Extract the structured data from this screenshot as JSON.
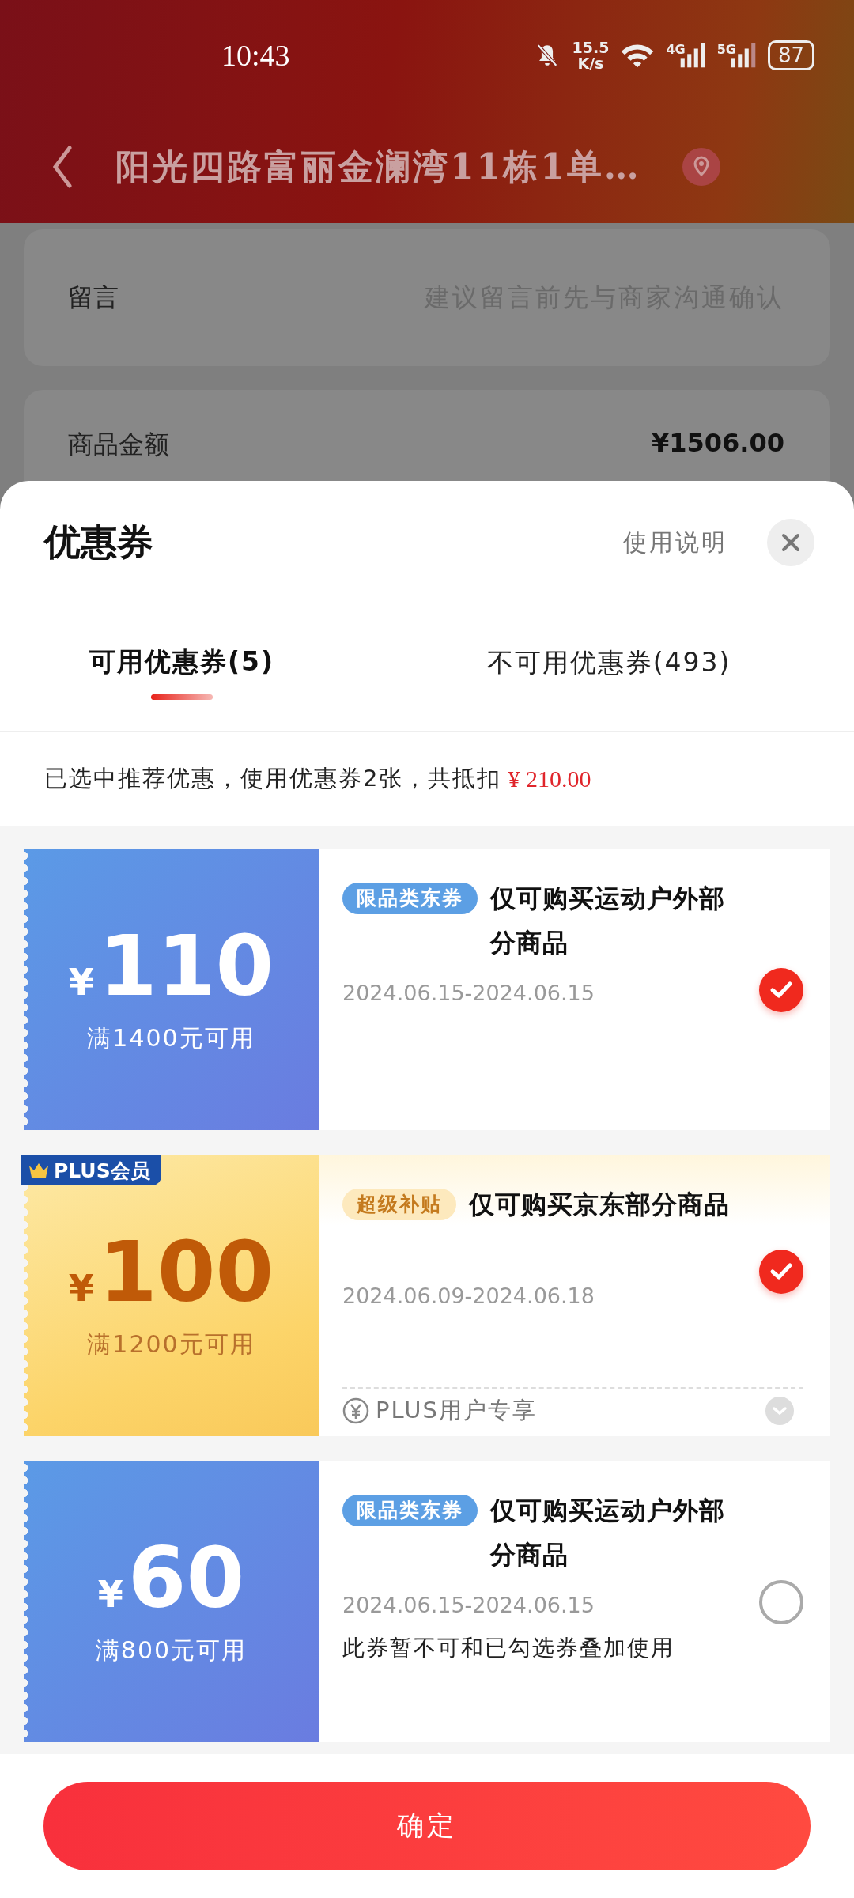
{
  "status_bar": {
    "time": "10:43",
    "speed_value": "15.5",
    "speed_unit": "K/s",
    "network_1": "4G",
    "network_2": "5G",
    "battery": "87"
  },
  "header": {
    "title": "阳光四路富丽金澜湾11栋1单…"
  },
  "background": {
    "message_label": "留言",
    "message_placeholder": "建议留言前先与商家沟通确认",
    "amount_label": "商品金额",
    "amount_value": "¥1506.00"
  },
  "sheet": {
    "title": "优惠券",
    "help_link": "使用说明",
    "tabs": [
      {
        "label": "可用优惠券(5)",
        "selected": true
      },
      {
        "label": "不可用优惠券(493)",
        "selected": false
      }
    ],
    "summary": {
      "text": "已选中推荐优惠，使用优惠券2张，共抵扣",
      "amount": "¥ 210.00"
    },
    "coupons": [
      {
        "kind": "standard",
        "currency": "¥",
        "amount": "110",
        "condition": "满1400元可用",
        "tag": "限品类东券",
        "title": "仅可购买运动户外部分商品",
        "date": "2024.06.15-2024.06.15",
        "selected": true
      },
      {
        "kind": "plus",
        "badge": "PLUS会员",
        "currency": "¥",
        "amount": "100",
        "condition": "满1200元可用",
        "tag": "超级补贴",
        "title": "仅可购买京东部分商品",
        "date": "2024.06.09-2024.06.18",
        "selected": true,
        "footer": "PLUS用户专享"
      },
      {
        "kind": "standard",
        "currency": "¥",
        "amount": "60",
        "condition": "满800元可用",
        "tag": "限品类东券",
        "title": "仅可购买运动户外部分商品",
        "date": "2024.06.15-2024.06.15",
        "note": "此券暂不可和已勾选券叠加使用",
        "selected": false
      }
    ],
    "confirm_button": "确定"
  }
}
